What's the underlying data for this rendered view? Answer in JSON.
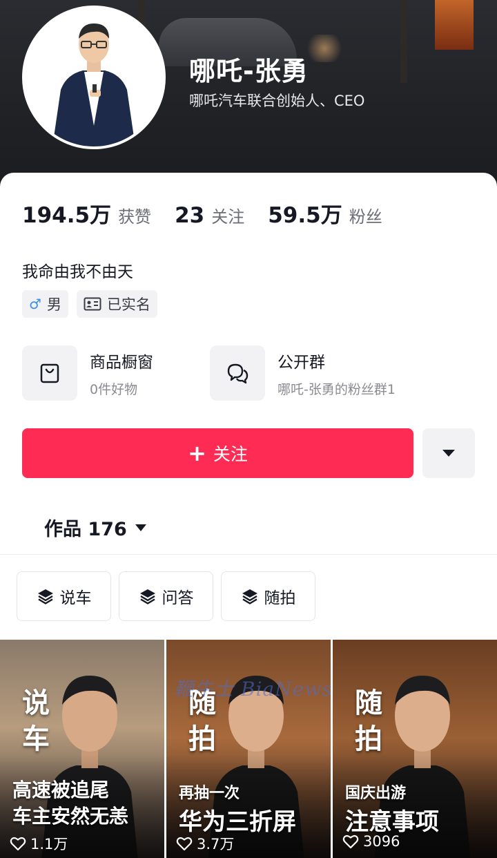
{
  "profile": {
    "name": "哪吒-张勇",
    "title": "哪吒汽车联合创始人、CEO"
  },
  "stats": [
    {
      "value": "194.5万",
      "label": "获赞"
    },
    {
      "value": "23",
      "label": "关注"
    },
    {
      "value": "59.5万",
      "label": "粉丝"
    }
  ],
  "bio": "我命由我不由天",
  "tags": {
    "gender": {
      "icon": "♂",
      "label": "男"
    },
    "verified": {
      "label": "已实名"
    }
  },
  "features": {
    "shop": {
      "title": "商品橱窗",
      "subtitle": "0件好物",
      "icon": "shopping-bag-icon"
    },
    "group": {
      "title": "公开群",
      "subtitle": "哪吒-张勇的粉丝群1",
      "icon": "chat-bubbles-icon"
    }
  },
  "follow_button": {
    "plus": "+",
    "label": "关注"
  },
  "works_tab": {
    "label": "作品 176"
  },
  "collections": [
    {
      "label": "说车",
      "icon": "collection-stack-icon"
    },
    {
      "label": "问答",
      "icon": "collection-stack-icon"
    },
    {
      "label": "随拍",
      "icon": "collection-stack-icon"
    }
  ],
  "videos": [
    {
      "tag_top": "说",
      "tag_bottom": "车",
      "line1": "高速被追尾",
      "line2": "车主安然无恙",
      "likes": "1.1万"
    },
    {
      "tag_top": "随",
      "tag_bottom": "拍",
      "line1": "再抽一次",
      "line2": "华为三折屏",
      "likes": "3.7万"
    },
    {
      "tag_top": "随",
      "tag_bottom": "拍",
      "line1": "国庆出游",
      "line2": "注意事项",
      "likes": "3096"
    }
  ],
  "watermark": "鞭牛士 BiaNews",
  "colors": {
    "follow": "#fe2c55",
    "header_bg": "#1f2125",
    "text_primary": "#161823",
    "text_secondary": "#8a8b91"
  }
}
